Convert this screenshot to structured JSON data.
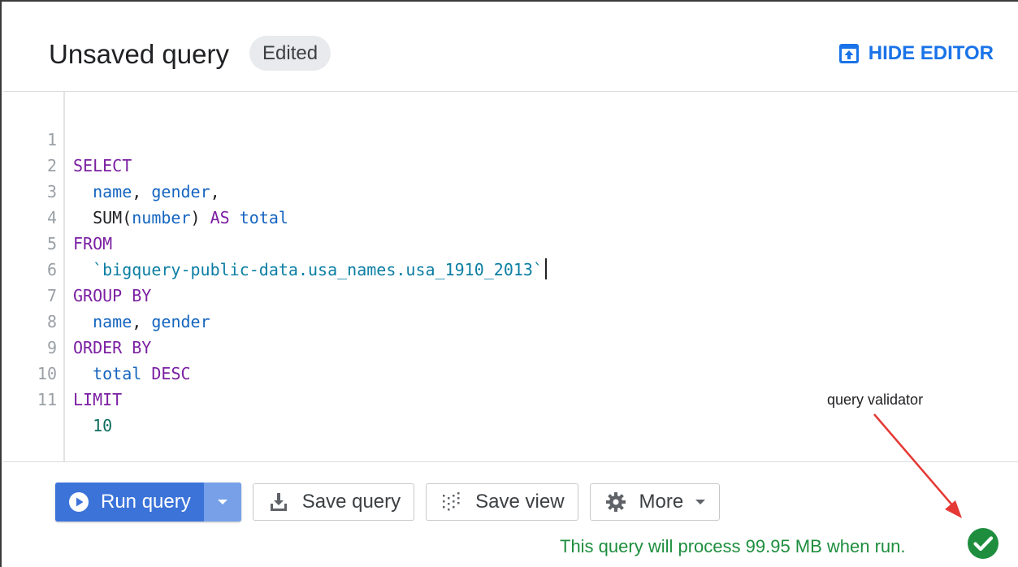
{
  "header": {
    "title": "Unsaved query",
    "status_chip": "Edited",
    "hide_editor_label": "HIDE EDITOR",
    "hide_editor_icon": "collapse-up-icon"
  },
  "editor": {
    "lines": [
      {
        "n": "1"
      },
      {
        "n": "2"
      },
      {
        "n": "3"
      },
      {
        "n": "4"
      },
      {
        "n": "5"
      },
      {
        "n": "6"
      },
      {
        "n": "7"
      },
      {
        "n": "8"
      },
      {
        "n": "9"
      },
      {
        "n": "10"
      },
      {
        "n": "11"
      }
    ],
    "tokens": {
      "l1_kw": "SELECT",
      "l2_indent": "  ",
      "l2_name": "name",
      "l2_sep": ", ",
      "l2_gender": "gender",
      "l2_end": ",",
      "l3_indent": "  ",
      "l3_sum": "SUM(",
      "l3_number": "number",
      "l3_close": ") ",
      "l3_as": "AS",
      "l3_sp": " ",
      "l3_total": "total",
      "l4_kw": "FROM",
      "l5_indent": "  ",
      "l5_table": "`bigquery-public-data.usa_names.usa_1910_2013`",
      "l6_kw": "GROUP BY",
      "l7_indent": "  ",
      "l7_name": "name",
      "l7_sep": ", ",
      "l7_gender": "gender",
      "l8_kw": "ORDER BY",
      "l9_indent": "  ",
      "l9_total": "total",
      "l9_sp": " ",
      "l9_desc": "DESC",
      "l10_kw": "LIMIT",
      "l11_indent": "  ",
      "l11_num": "10"
    }
  },
  "toolbar": {
    "run_label": "Run query",
    "run_icon": "play-circle-icon",
    "save_query_label": "Save query",
    "save_query_icon": "download-tray-icon",
    "save_view_label": "Save view",
    "save_view_icon": "grid-dots-icon",
    "more_label": "More",
    "more_icon": "gear-icon"
  },
  "validator": {
    "message": "This query will process 99.95 MB when run.",
    "icon": "check-circle-icon",
    "annotation": "query validator"
  },
  "colors": {
    "accent": "#1a73e8",
    "run_button": "#3b73d9",
    "success": "#1e8e3e",
    "keyword": "#7b1fa2",
    "identifier": "#1565c0",
    "annotation_arrow": "#e53935"
  }
}
